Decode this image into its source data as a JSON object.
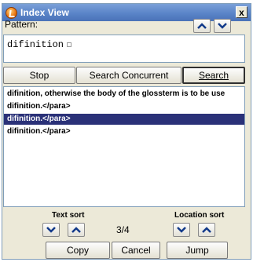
{
  "window": {
    "title": "Index View",
    "close_label": "x"
  },
  "pattern": {
    "label": "Pattern:",
    "value": "difinition"
  },
  "buttons": {
    "stop": "Stop",
    "search_concurrent": "Search Concurrent",
    "search": "Search",
    "copy": "Copy",
    "cancel": "Cancel",
    "jump": "Jump"
  },
  "results": [
    {
      "text": "difinition, otherwise the body of the glossterm is to be use",
      "selected": false
    },
    {
      "text": "difinition.</para>",
      "selected": false
    },
    {
      "text": "difinition.</para>",
      "selected": true
    },
    {
      "text": "difinition.</para>",
      "selected": false
    }
  ],
  "sort": {
    "text_label": "Text sort",
    "location_label": "Location sort"
  },
  "counter": "3/4",
  "colors": {
    "selection": "#2a3178",
    "titlebar": "#5a84c8",
    "window_bg": "#ece9d8"
  },
  "icons": [
    "app-icon",
    "close-icon",
    "up-arrow-icon",
    "down-arrow-icon"
  ]
}
